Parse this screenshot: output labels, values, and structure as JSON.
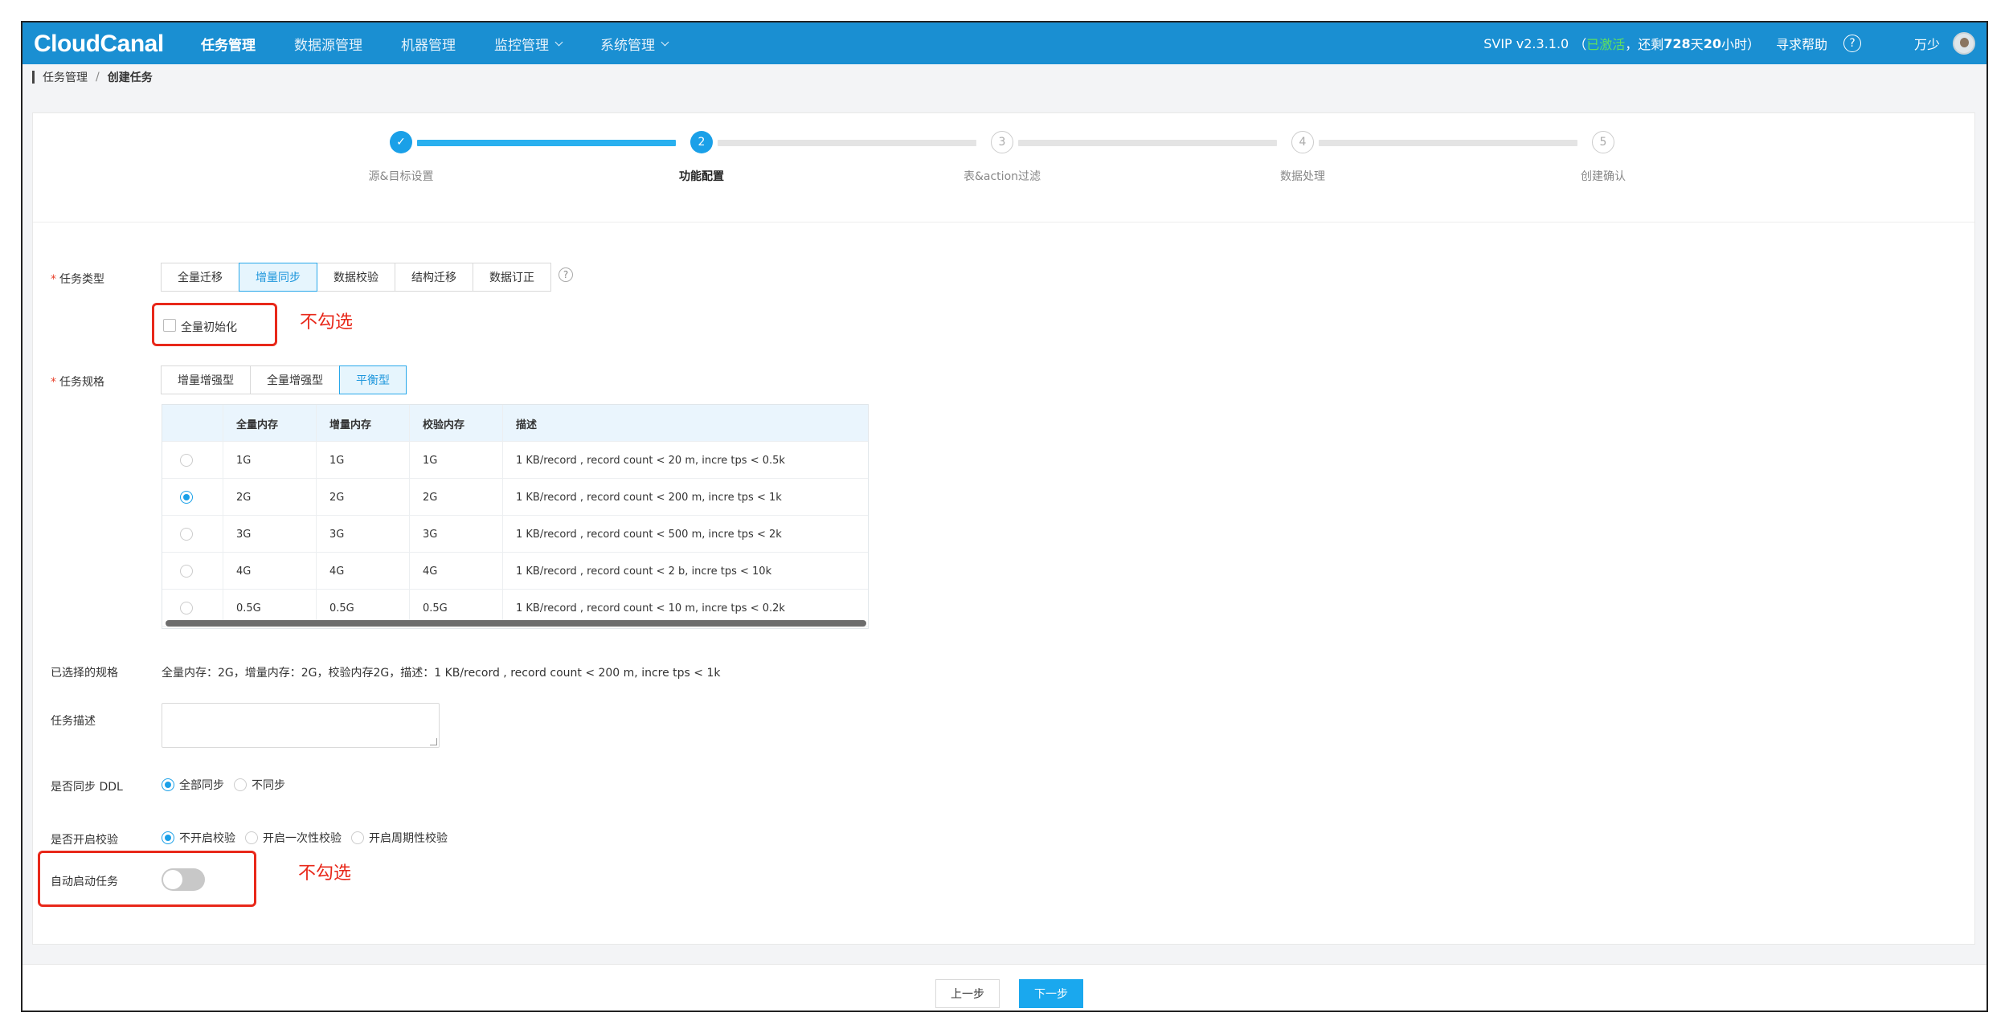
{
  "header": {
    "logo": "CloudCanal",
    "nav": [
      {
        "label": "任务管理",
        "active": true,
        "dropdown": false
      },
      {
        "label": "数据源管理",
        "active": false,
        "dropdown": false
      },
      {
        "label": "机器管理",
        "active": false,
        "dropdown": false
      },
      {
        "label": "监控管理",
        "active": false,
        "dropdown": true
      },
      {
        "label": "系统管理",
        "active": false,
        "dropdown": true
      }
    ],
    "version": "SVIP v2.3.1.0",
    "open_paren": "（",
    "activated": "已激活",
    "remain_prefix": "，还剩",
    "remain_days": "728",
    "day_unit": "天",
    "remain_hours": "20",
    "hour_unit": "小时）",
    "help_label": "寻求帮助",
    "help_icon": "?",
    "user": "万少"
  },
  "breadcrumb": {
    "parent": "任务管理",
    "separator": "/",
    "current": "创建任务"
  },
  "steps": [
    {
      "num": "1",
      "label": "源&目标设置",
      "state": "done"
    },
    {
      "num": "2",
      "label": "功能配置",
      "state": "active"
    },
    {
      "num": "3",
      "label": "表&action过滤",
      "state": "todo"
    },
    {
      "num": "4",
      "label": "数据处理",
      "state": "todo"
    },
    {
      "num": "5",
      "label": "创建确认",
      "state": "todo"
    }
  ],
  "form": {
    "required_mark": "*",
    "task_type_label": "任务类型",
    "task_types": [
      "全量迁移",
      "增量同步",
      "数据校验",
      "结构迁移",
      "数据订正"
    ],
    "task_type_selected": "增量同步",
    "full_init_label": "全量初始化",
    "full_init_checked": false,
    "annotation_no_check_1": "不勾选",
    "spec_label": "任务规格",
    "spec_types": [
      "增量增强型",
      "全量增强型",
      "平衡型"
    ],
    "spec_selected": "平衡型",
    "spec_table": {
      "columns": [
        "",
        "全量内存",
        "增量内存",
        "校验内存",
        "描述"
      ],
      "rows": [
        {
          "selected": false,
          "full": "1G",
          "incr": "1G",
          "check": "1G",
          "desc": "1 KB/record , record count < 20 m, incre tps < 0.5k"
        },
        {
          "selected": true,
          "full": "2G",
          "incr": "2G",
          "check": "2G",
          "desc": "1 KB/record , record count < 200 m, incre tps < 1k"
        },
        {
          "selected": false,
          "full": "3G",
          "incr": "3G",
          "check": "3G",
          "desc": "1 KB/record , record count < 500 m, incre tps < 2k"
        },
        {
          "selected": false,
          "full": "4G",
          "incr": "4G",
          "check": "4G",
          "desc": "1 KB/record , record count < 2 b, incre tps < 10k"
        },
        {
          "selected": false,
          "full": "0.5G",
          "incr": "0.5G",
          "check": "0.5G",
          "desc": "1 KB/record , record count < 10 m, incre tps < 0.2k"
        }
      ]
    },
    "selected_spec_label": "已选择的规格",
    "selected_spec_value": "全量内存：2G，增量内存：2G，校验内存2G，描述：1 KB/record , record count < 200 m, incre tps < 1k",
    "desc_label": "任务描述",
    "desc_value": "",
    "ddl_label": "是否同步 DDL",
    "ddl_options": [
      "全部同步",
      "不同步"
    ],
    "ddl_selected": "全部同步",
    "check_label": "是否开启校验",
    "check_options": [
      "不开启校验",
      "开启一次性校验",
      "开启周期性校验"
    ],
    "check_selected": "不开启校验",
    "auto_start_label": "自动启动任务",
    "auto_start_on": false,
    "annotation_no_check_2": "不勾选"
  },
  "footer": {
    "prev": "上一步",
    "next": "下一步"
  },
  "colors": {
    "brand": "#1a8fd2",
    "accent": "#1aa0e8",
    "annotation": "#e8281a",
    "activated": "#5fe05f"
  }
}
